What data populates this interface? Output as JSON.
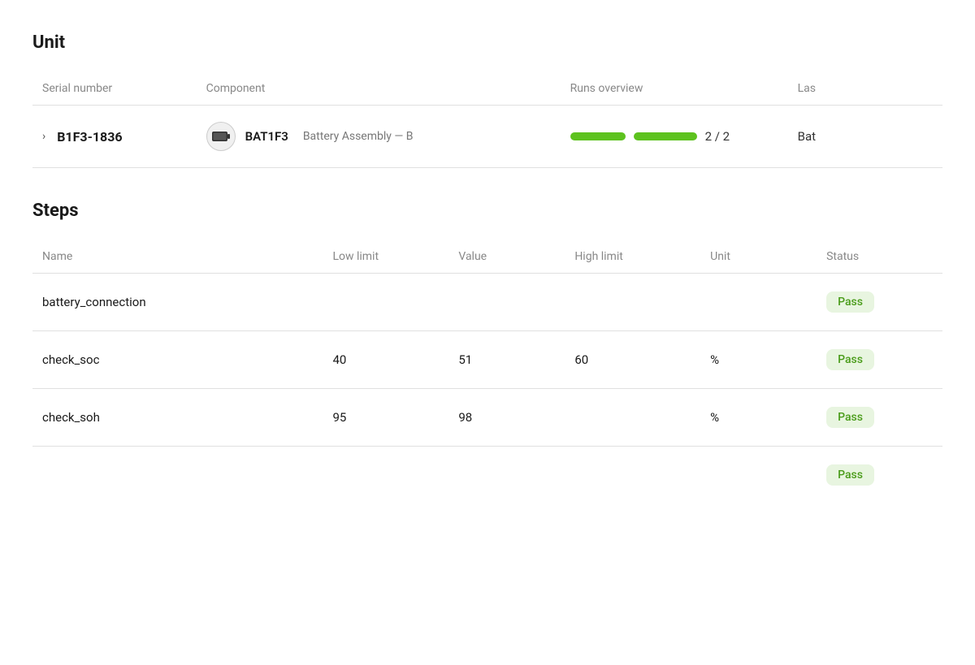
{
  "unit_section": {
    "title": "Unit",
    "columns": {
      "serial_number": "Serial number",
      "component": "Component",
      "runs_overview": "Runs overview",
      "last": "Las"
    },
    "row": {
      "serial_number": "B1F3-1836",
      "component_code": "BAT1F3",
      "component_name": "Battery Assembly — B",
      "component_icon": "🔋",
      "runs_fraction": "2 / 2",
      "last_prefix": "Bat"
    }
  },
  "steps_section": {
    "title": "Steps",
    "columns": {
      "name": "Name",
      "low_limit": "Low limit",
      "value": "Value",
      "high_limit": "High limit",
      "unit": "Unit",
      "status": "Status"
    },
    "rows": [
      {
        "name": "battery_connection",
        "low_limit": "",
        "value": "",
        "high_limit": "",
        "unit": "",
        "status": "Pass"
      },
      {
        "name": "check_soc",
        "low_limit": "40",
        "value": "51",
        "high_limit": "60",
        "unit": "%",
        "status": "Pass"
      },
      {
        "name": "check_soh",
        "low_limit": "95",
        "value": "98",
        "high_limit": "",
        "unit": "%",
        "status": "Pass"
      },
      {
        "name": "",
        "low_limit": "",
        "value": "",
        "high_limit": "",
        "unit": "",
        "status": "Pass"
      }
    ]
  },
  "colors": {
    "pass_bg": "#e8f5e0",
    "pass_text": "#4a9c1a",
    "run_bar": "#5dc21e"
  }
}
